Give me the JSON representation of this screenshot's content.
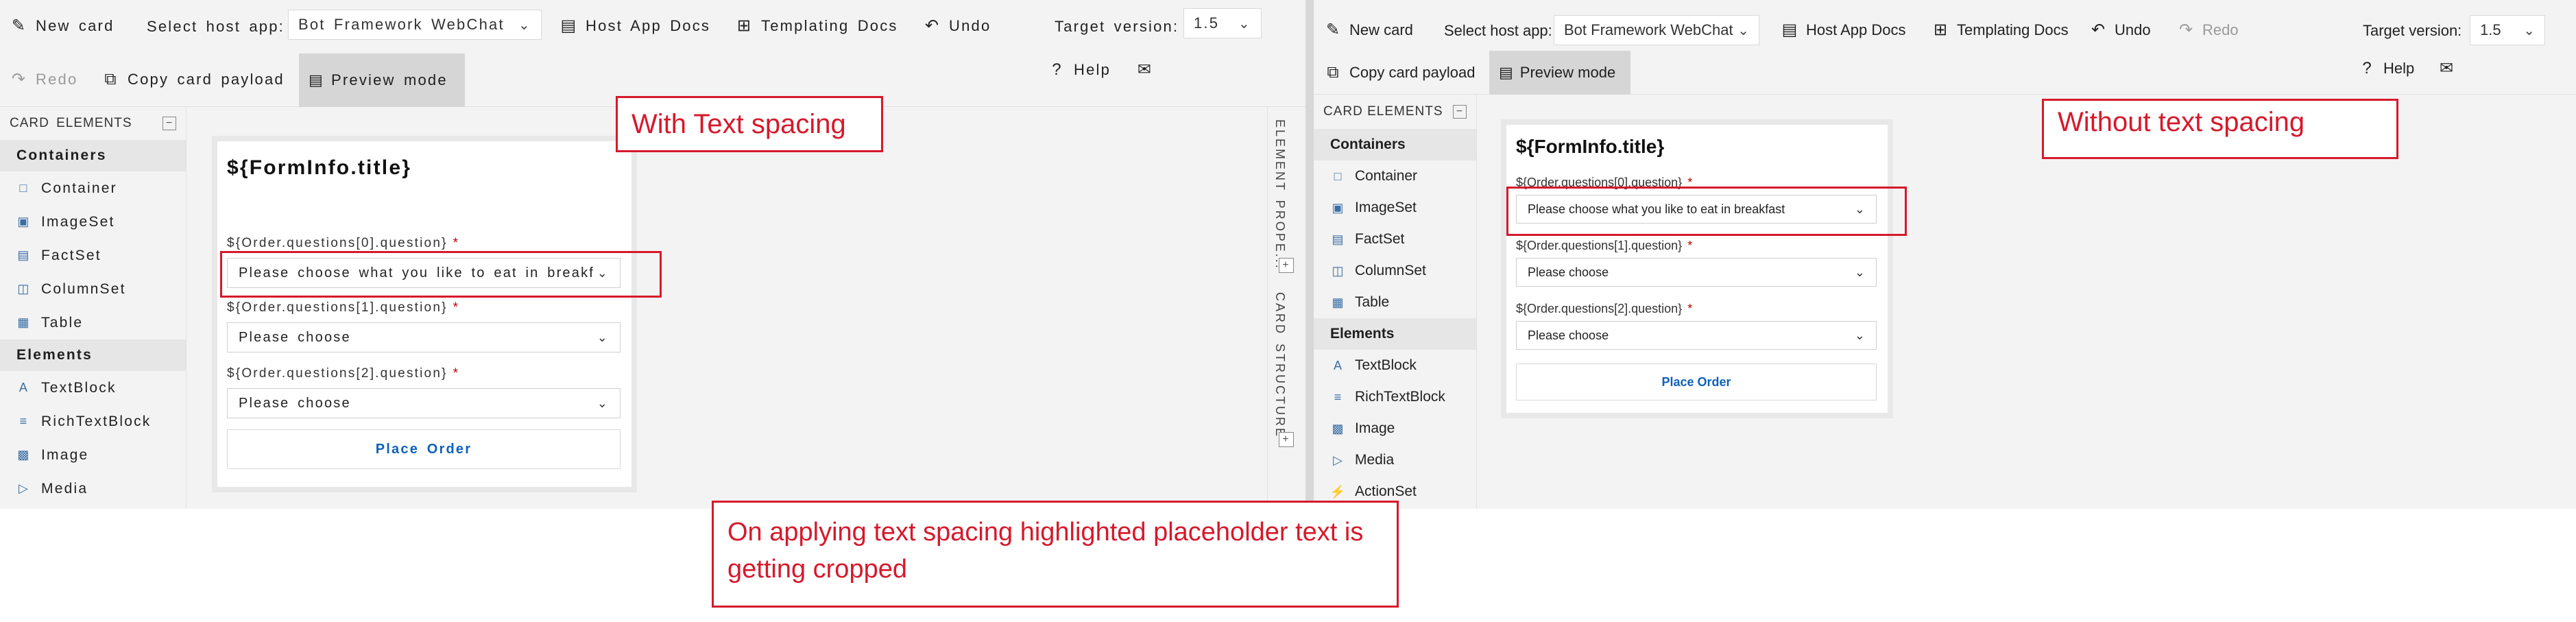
{
  "toolbar": {
    "new_card": "New card",
    "select_host_label": "Select host app:",
    "host_app": "Bot Framework WebChat",
    "host_app_docs": "Host App Docs",
    "templating_docs": "Templating Docs",
    "undo": "Undo",
    "redo": "Redo",
    "target_version_label": "Target version:",
    "target_version": "1.5",
    "copy_card_payload": "Copy card payload",
    "preview_mode": "Preview mode",
    "help": "Help"
  },
  "sidebar": {
    "header": "CARD ELEMENTS",
    "containers_label": "Containers",
    "elements_label": "Elements",
    "left_containers": [
      "Container",
      "ImageSet",
      "FactSet",
      "ColumnSet",
      "Table"
    ],
    "left_elements": [
      "TextBlock",
      "RichTextBlock",
      "Image",
      "Media"
    ],
    "right_containers": [
      "Container",
      "ImageSet",
      "FactSet",
      "ColumnSet",
      "Table"
    ],
    "right_elements": [
      "TextBlock",
      "RichTextBlock",
      "Image",
      "Media",
      "ActionSet"
    ]
  },
  "card": {
    "title": "${FormInfo.title}",
    "q0_label": "${Order.questions[0].question}",
    "q1_label": "${Order.questions[1].question}",
    "q2_label": "${Order.questions[2].question}",
    "required_mark": "*",
    "q0_placeholder_cropped": "Please choose what you like to eat in breakf",
    "q0_placeholder_full": "Please choose what you like to eat in breakfast",
    "q1_placeholder": "Please choose",
    "q2_placeholder": "Please choose",
    "action": "Place Order"
  },
  "rail": {
    "element_properties": "ELEMENT PROPE...",
    "card_structure": "CARD STRUCTURE"
  },
  "annotations": {
    "with_spacing": "With Text spacing",
    "without_spacing": "Without text spacing",
    "issue": "On applying text spacing highlighted placeholder text is getting cropped"
  },
  "colors": {
    "annotation_red": "#d6192b",
    "link_blue": "#0e62b8",
    "panel_bg": "#f3f3f3"
  }
}
